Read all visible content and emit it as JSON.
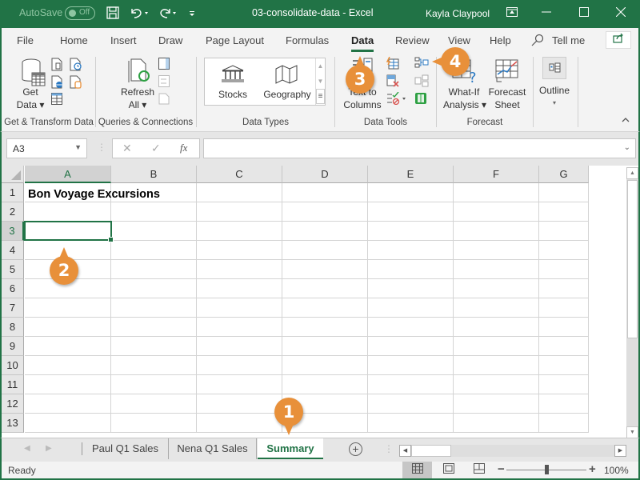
{
  "titlebar": {
    "autosave_label": "AutoSave",
    "autosave_state": "Off",
    "doc_title": "03-consolidate-data  -  Excel",
    "user": "Kayla Claypool",
    "icons": [
      "save-icon",
      "undo-icon",
      "redo-icon",
      "customize-qat-icon",
      "ribbon-display-icon",
      "minimize-icon",
      "maximize-icon",
      "close-icon"
    ]
  },
  "tabs": {
    "items": [
      {
        "label": "File"
      },
      {
        "label": "Home"
      },
      {
        "label": "Insert"
      },
      {
        "label": "Draw"
      },
      {
        "label": "Page Layout"
      },
      {
        "label": "Formulas"
      },
      {
        "label": "Data",
        "active": true
      },
      {
        "label": "Review"
      },
      {
        "label": "View"
      },
      {
        "label": "Help"
      }
    ],
    "tell_me": "Tell me"
  },
  "ribbon": {
    "groups": {
      "get_transform": {
        "label": "Get & Transform Data",
        "get_data_line1": "Get",
        "get_data_line2": "Data ▾"
      },
      "queries": {
        "label": "Queries & Connections",
        "refresh_line1": "Refresh",
        "refresh_line2": "All ▾"
      },
      "data_types": {
        "label": "Data Types",
        "stocks": "Stocks",
        "geography": "Geography"
      },
      "data_tools": {
        "label": "Data Tools",
        "text_to_columns_line1": "Text to",
        "text_to_columns_line2": "Columns"
      },
      "forecast": {
        "label": "Forecast",
        "whatif_line1": "What-If",
        "whatif_line2": "Analysis ▾",
        "forecast_line1": "Forecast",
        "forecast_line2": "Sheet"
      },
      "outline": {
        "label": "Outline",
        "arrow": "▾"
      }
    }
  },
  "formulabar": {
    "namebox": "A3",
    "cancel": "✕",
    "enter": "✓",
    "fx": "fx",
    "formula": ""
  },
  "grid": {
    "columns": [
      "A",
      "B",
      "C",
      "D",
      "E",
      "F",
      "G"
    ],
    "rows": [
      "1",
      "2",
      "3",
      "4",
      "5",
      "6",
      "7",
      "8",
      "9",
      "10",
      "11",
      "12",
      "13"
    ],
    "selected_cell": "A3",
    "cells": {
      "A1": "Bon Voyage Excursions"
    }
  },
  "sheets": {
    "tabs": [
      {
        "label": "Paul Q1 Sales"
      },
      {
        "label": "Nena Q1 Sales"
      },
      {
        "label": "Summary",
        "active": true
      }
    ],
    "add_sheet": "+"
  },
  "status": {
    "ready": "Ready",
    "zoom_percent": "100%",
    "zoom_minus": "−",
    "zoom_plus": "+"
  },
  "callouts": {
    "c1": "1",
    "c2": "2",
    "c3": "3",
    "c4": "4"
  },
  "colors": {
    "excel_green": "#217346",
    "callout_orange": "#e8903a"
  }
}
